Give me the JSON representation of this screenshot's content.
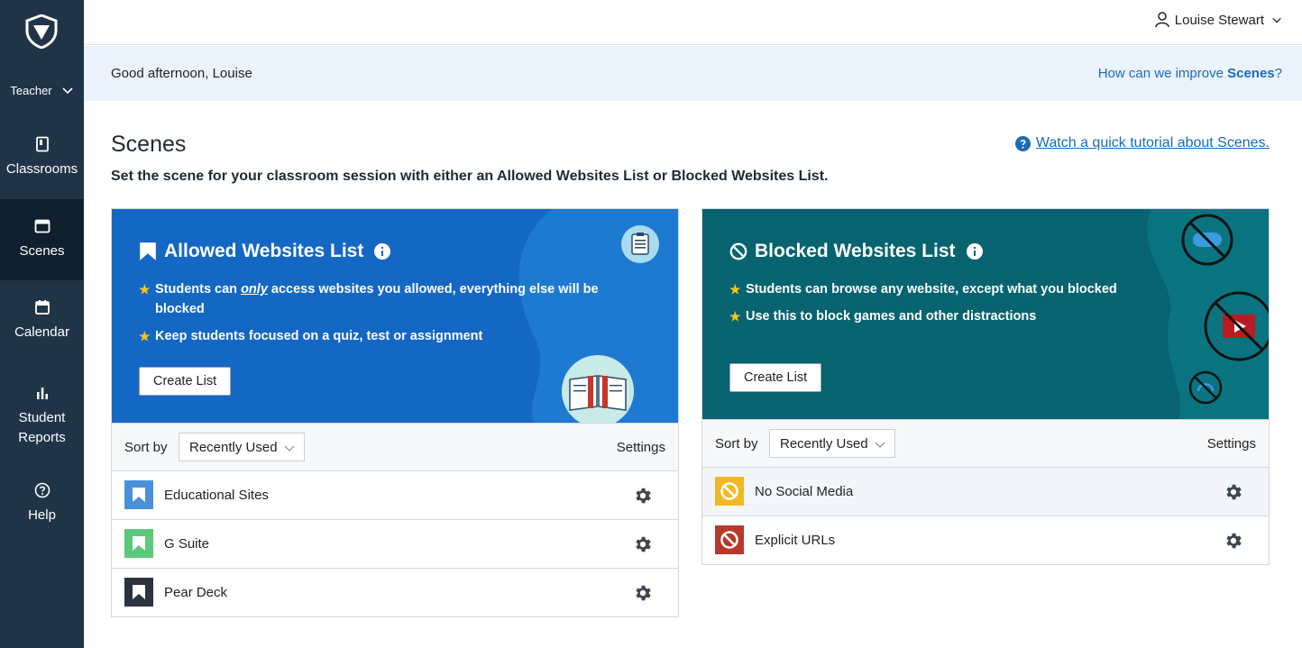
{
  "sidebar": {
    "role": "Teacher",
    "items": [
      {
        "label": "Classrooms",
        "icon": "book-icon"
      },
      {
        "label": "Scenes",
        "icon": "browser-window-icon",
        "active": true
      },
      {
        "label": "Calendar",
        "icon": "calendar-icon"
      },
      {
        "label": "Student Reports",
        "icon": "bar-chart-icon"
      },
      {
        "label": "Help",
        "icon": "help-icon"
      }
    ]
  },
  "header": {
    "user_name": "Louise Stewart",
    "greeting": "Good afternoon, Louise",
    "improve_prefix": "How can we improve ",
    "improve_bold": "Scenes",
    "improve_suffix": "?"
  },
  "main": {
    "title": "Scenes",
    "subtitle": "Set the scene for your classroom session with either an Allowed Websites List or Blocked Websites List.",
    "tutorial_link": "Watch a quick tutorial about Scenes."
  },
  "allowed": {
    "title": "Allowed Websites List",
    "bullet1_pre": "Students can ",
    "bullet1_em": "only",
    "bullet1_post": " access websites you allowed, everything else will be blocked",
    "bullet2": "Keep students focused on a quiz, test or assignment",
    "create_label": "Create List",
    "sort_label": "Sort by",
    "sort_value": "Recently Used",
    "settings_label": "Settings",
    "colors": {
      "hero": "#1467c2"
    },
    "lists": [
      {
        "name": "Educational Sites",
        "color": "#4a90d9"
      },
      {
        "name": "G Suite",
        "color": "#5cc97a"
      },
      {
        "name": "Pear Deck",
        "color": "#2a3340"
      }
    ]
  },
  "blocked": {
    "title": "Blocked Websites List",
    "bullet1": "Students can browse any website, except what you blocked",
    "bullet2": "Use this to block games and other distractions",
    "create_label": "Create List",
    "sort_label": "Sort by",
    "sort_value": "Recently Used",
    "settings_label": "Settings",
    "colors": {
      "hero": "#07636f"
    },
    "lists": [
      {
        "name": "No Social Media",
        "color": "#f2b824"
      },
      {
        "name": "Explicit URLs",
        "color": "#b8392c"
      }
    ]
  }
}
